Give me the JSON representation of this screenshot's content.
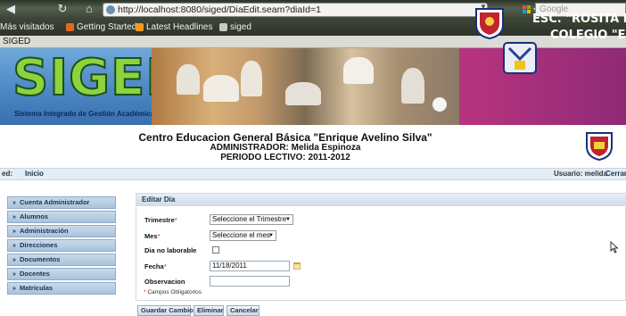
{
  "browser": {
    "url": "http://localhost:8080/siged/DiaEdit.seam?diaId=1",
    "search_placeholder": "Google",
    "bookmarks": [
      "Más visitados",
      "Getting Started",
      "Latest Headlines",
      "siged"
    ],
    "tab_title": "SIGED"
  },
  "banner": {
    "logo_text": "SIGED",
    "logo_subtitle": "Sistema Integrado de Gestión Académica",
    "school_line1": "ESC. \"ROSITA PARE",
    "school_line2": "COLEGIO \"EL CH"
  },
  "header": {
    "line1": "Centro Educacion General Básica \"Enrique Avelino Silva\"",
    "line2": "ADMINISTRADOR: Melida Espinoza",
    "line3": "PERIODO LECTIVO: 2011-2012"
  },
  "breadcrumb": {
    "prefix": "ed:",
    "home": "Inicio",
    "user": "Usuario: melida",
    "logout": "Cerrar"
  },
  "menu": {
    "items": [
      {
        "label": "Cuenta Administrador"
      },
      {
        "label": "Alumnos"
      },
      {
        "label": "Administración"
      },
      {
        "label": "Direcciones"
      },
      {
        "label": "Documentos"
      },
      {
        "label": "Docentes"
      },
      {
        "label": "Matrículas"
      }
    ]
  },
  "form": {
    "title": "Editar Dia",
    "trimestre_label": "Trimestre",
    "trimestre_value": "Seleccione el Trimestre",
    "mes_label": "Mes",
    "mes_value": "Seleccione el mes",
    "no_laborable_label": "Dia no laborable",
    "fecha_label": "Fecha",
    "fecha_value": "11/18/2011",
    "observacion_label": "Observacion",
    "required_star": "*",
    "required_note": "Campos Obligatorios",
    "buttons": {
      "save": "Guardar Cambios",
      "delete": "Eliminar",
      "cancel": "Cancelar"
    }
  },
  "colors": {
    "banner_magenta": "#9a2b7a",
    "menu_blue": "#a9c3dc",
    "required_red": "#dd1111"
  }
}
